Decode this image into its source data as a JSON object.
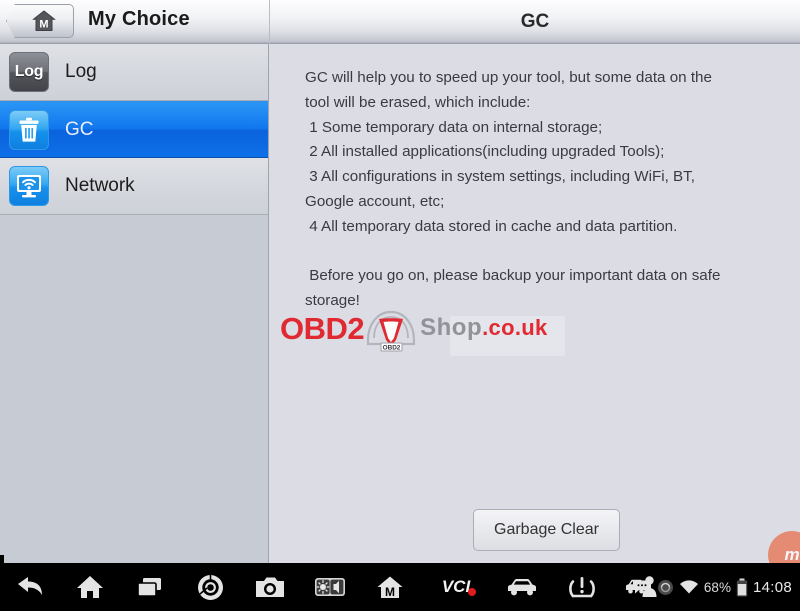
{
  "header": {
    "home_button_icon": "house-m-icon",
    "left_title": "My Choice",
    "main_title": "GC"
  },
  "sidebar": {
    "items": [
      {
        "label": "Log",
        "icon": "log-icon",
        "icon_text": "Log",
        "selected": false
      },
      {
        "label": "GC",
        "icon": "trash-can-icon",
        "selected": true
      },
      {
        "label": "Network",
        "icon": "network-monitor-wifi-icon",
        "selected": false
      }
    ]
  },
  "main": {
    "body_text": "GC will help you to speed up your tool, but some data on the\ntool will be erased, which include:\n 1 Some temporary data on internal storage;\n 2 All installed applications(including upgraded Tools);\n 3 All configurations in system settings, including WiFi, BT,\nGoogle account, etc;\n 4 All temporary data stored in cache and data partition.\n\n Before you go on, please backup your important data on safe\nstorage!",
    "action_button": "Garbage Clear",
    "watermark": {
      "brand": "OBD2",
      "shop": "Shop",
      "tld": ".co.uk",
      "plate": "OBD2",
      "corner_mark": "m"
    },
    "colors": {
      "accent_blue": "#1277ee",
      "watermark_red": "#e11b22",
      "watermark_gray": "#8c8c94",
      "panel_bg": "#dcdce5",
      "sidebar_bg": "#c7cbd4"
    }
  },
  "navbar": {
    "buttons": [
      {
        "name": "back",
        "icon": "back-arrow-icon"
      },
      {
        "name": "home",
        "icon": "home-icon"
      },
      {
        "name": "recent-apps",
        "icon": "recent-apps-icon"
      },
      {
        "name": "browser",
        "icon": "chrome-icon"
      },
      {
        "name": "screenshot",
        "icon": "camera-icon"
      },
      {
        "name": "display-sound",
        "icon": "brightness-volume-icon"
      },
      {
        "name": "maxi-home",
        "icon": "house-m-icon"
      },
      {
        "name": "vci",
        "icon": "vci-icon",
        "label": "VCI"
      },
      {
        "name": "vehicle",
        "icon": "car-icon"
      },
      {
        "name": "tpms",
        "icon": "tpms-warning-icon"
      },
      {
        "name": "remote-support",
        "icon": "car-person-icon"
      }
    ],
    "status": {
      "messages_icon": "message-bubble-icon",
      "sync_icon": "sync-circle-icon",
      "wifi_icon": "wifi-icon",
      "battery_percent": "68%",
      "battery_icon": "battery-icon",
      "time": "14:08"
    }
  }
}
